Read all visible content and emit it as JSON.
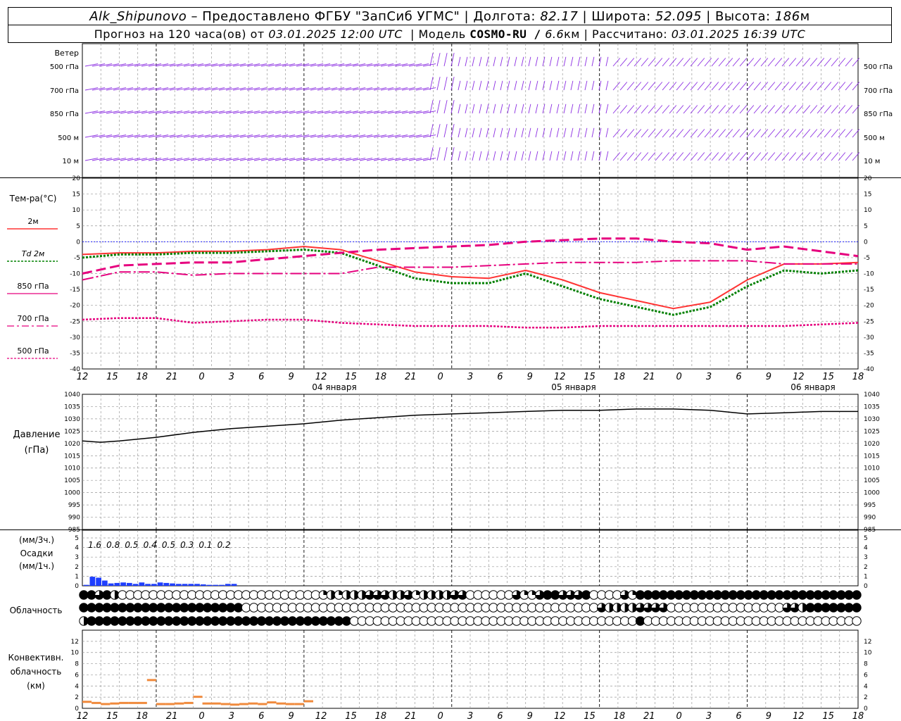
{
  "header": {
    "station": "Alk_Shipunovo",
    "provider": "– Предоставлено ФГБУ \"ЗапСиб УГМС\" |",
    "lon_label": "Долгота:",
    "lon": "82.17",
    "lat_label": "| Широта:",
    "lat": "52.095",
    "alt_label": "| Высота:",
    "alt": "186",
    "alt_unit": "м"
  },
  "subheader": {
    "forecast_label": "Прогноз на 120 часа(ов) от",
    "forecast_from": "03.01.2025 12:00 UTC",
    "model_label": "| Модель",
    "model": "COSMO-RU /",
    "resolution": "6.6",
    "resolution_unit": "км",
    "computed_label": "| Рассчитано:",
    "computed": "03.01.2025 16:39 UTC"
  },
  "panels": {
    "wind": {
      "title": "Ветер",
      "levels": [
        "500 гПа",
        "700 гПа",
        "850 гПа",
        "500 м",
        "10 м"
      ]
    },
    "temperature": {
      "title": "Тем-ра(°С)",
      "legend": [
        "2м",
        "Td 2м",
        "850 гПа",
        "700 гПа",
        "500 гПа"
      ]
    },
    "pressure": {
      "title": "Давление",
      "unit": "(гПа)"
    },
    "precip": {
      "unit3": "(мм/3ч.)",
      "title": "Осадки",
      "unit1": "(мм/1ч.)"
    },
    "cloud": {
      "title": "Облачность"
    },
    "convective": {
      "title": "Конвективн.",
      "title2": "облачность",
      "unit": "(км)"
    }
  },
  "time_axis": {
    "hour_labels": [
      "12",
      "15",
      "18",
      "21",
      "0",
      "3",
      "6",
      "9",
      "12",
      "15",
      "18",
      "21",
      "0",
      "3",
      "6",
      "9",
      "12",
      "15",
      "18",
      "21",
      "0",
      "3",
      "6",
      "9",
      "12",
      "15",
      "18"
    ],
    "dates": [
      "04 января",
      "05 января",
      "06 января"
    ]
  },
  "chart_data": [
    {
      "type": "line",
      "name": "temperature",
      "ylim": [
        -40,
        20
      ],
      "x_hours": [
        0,
        6,
        12,
        18,
        24,
        30,
        36,
        42,
        48,
        54,
        60,
        66,
        72,
        78,
        84,
        90,
        96,
        102,
        108,
        114,
        120,
        126
      ],
      "series": [
        {
          "name": "2м",
          "color": "#ff3333",
          "values": [
            -4,
            -3.5,
            -3.5,
            -3,
            -3,
            -2.5,
            -1.5,
            -2.5,
            -6,
            -9.5,
            -11,
            -11.5,
            -9,
            -12,
            -16,
            -18.5,
            -21,
            -19,
            -12,
            -7,
            -7,
            -6.5
          ]
        },
        {
          "name": "Td 2м",
          "color": "#008000",
          "values": [
            -5,
            -4,
            -4,
            -3.5,
            -3.5,
            -3,
            -2.5,
            -3.5,
            -7.5,
            -11.5,
            -13,
            -13,
            -10,
            -14,
            -18,
            -20.5,
            -23,
            -20.5,
            -14,
            -9,
            -10,
            -9
          ]
        },
        {
          "name": "850 гПа",
          "color": "#e6007e",
          "values": [
            -12,
            -9.5,
            -9.5,
            -10.5,
            -10,
            -10,
            -10,
            -10,
            -8,
            -8,
            -8,
            -7.5,
            -7,
            -6.5,
            -6.5,
            -6.5,
            -6,
            -6,
            -6,
            -7,
            -7,
            -7
          ]
        },
        {
          "name": "700 гПа",
          "color": "#e6007e",
          "values": [
            -10,
            -7.5,
            -7,
            -6.5,
            -6.5,
            -5.5,
            -4.5,
            -3.5,
            -2.5,
            -2,
            -1.5,
            -1,
            0,
            0.5,
            1,
            1,
            0,
            -0.5,
            -2.5,
            -1.5,
            -3,
            -4.5
          ]
        },
        {
          "name": "500 гПа",
          "color": "#e6007e",
          "values": [
            -24.5,
            -24,
            -24,
            -25.5,
            -25,
            -24.5,
            -24.5,
            -25.5,
            -26,
            -26.5,
            -26.5,
            -26.5,
            -27,
            -27,
            -26.5,
            -26.5,
            -26.5,
            -26.5,
            -26.5,
            -26.5,
            -26,
            -25.5
          ]
        }
      ]
    },
    {
      "type": "line",
      "name": "pressure",
      "ylim": [
        985,
        1040
      ],
      "x_hours": [
        0,
        3,
        6,
        12,
        18,
        24,
        30,
        36,
        42,
        48,
        54,
        60,
        66,
        72,
        78,
        84,
        90,
        96,
        102,
        108,
        114,
        120,
        126
      ],
      "values": [
        1021,
        1020.5,
        1021,
        1022.5,
        1024.5,
        1026,
        1027,
        1028,
        1029.5,
        1030.5,
        1031.5,
        1032,
        1032.5,
        1033,
        1033.5,
        1033.5,
        1034,
        1034,
        1033.5,
        1032,
        1032.5,
        1033,
        1033
      ]
    },
    {
      "type": "bar",
      "name": "precipitation_1h",
      "ylim": [
        0,
        5
      ],
      "values": [
        0.1,
        0.95,
        0.85,
        0.55,
        0.25,
        0.3,
        0.35,
        0.3,
        0.2,
        0.35,
        0.2,
        0.2,
        0.35,
        0.3,
        0.25,
        0.2,
        0.2,
        0.2,
        0.2,
        0.15,
        0.1,
        0.1,
        0.1,
        0.2,
        0.2
      ]
    },
    {
      "type": "bar",
      "name": "precipitation_3h_labels",
      "values": [
        "1.6",
        "0.8",
        "0.5",
        "0.4",
        "0.5",
        "0.3",
        "0.1",
        "0.2"
      ]
    },
    {
      "type": "bar",
      "name": "convective_cloud",
      "ylim": [
        0,
        14
      ],
      "values": [
        1.1,
        0.9,
        0.7,
        0.8,
        0.9,
        0.9,
        0.9,
        5,
        0.7,
        0.7,
        0.8,
        0.9,
        2,
        0.8,
        0.8,
        0.7,
        0.6,
        0.7,
        0.8,
        0.7,
        1,
        0.8,
        0.7,
        0.7,
        1.2
      ]
    },
    {
      "type": "table",
      "name": "cloud_cover",
      "levels": [
        "upper",
        "middle",
        "lower"
      ],
      "encoding": "0=clear..4=overcast per 3h step",
      "upper": [
        4,
        4,
        3,
        4,
        2,
        0,
        0,
        0,
        0,
        0,
        0,
        0,
        0,
        0,
        0,
        0,
        0,
        0,
        0,
        0,
        0,
        0,
        0,
        0,
        0,
        0,
        0,
        0,
        0,
        0,
        0,
        1,
        2,
        1,
        2,
        2,
        2,
        3,
        3,
        3,
        2,
        2,
        3,
        1,
        2,
        2,
        2,
        2,
        3,
        3,
        0,
        0,
        0,
        0,
        0,
        0,
        3,
        1,
        1,
        3,
        4,
        4,
        3,
        3,
        3,
        4,
        0,
        0,
        0,
        0,
        3,
        1,
        4,
        4,
        4,
        4,
        4,
        4,
        4,
        4,
        4,
        4,
        4,
        4,
        4,
        4,
        4,
        4,
        4,
        4,
        4,
        4,
        4,
        4,
        4,
        4,
        4,
        4,
        4,
        4,
        4
      ],
      "middle": [
        4,
        4,
        4,
        4,
        4,
        4,
        4,
        4,
        4,
        4,
        4,
        4,
        4,
        4,
        4,
        4,
        4,
        4,
        4,
        4,
        4,
        0,
        0,
        0,
        0,
        0,
        0,
        0,
        0,
        0,
        0,
        0,
        0,
        0,
        0,
        0,
        0,
        0,
        0,
        0,
        0,
        0,
        0,
        0,
        0,
        0,
        0,
        0,
        0,
        0,
        0,
        0,
        0,
        0,
        0,
        0,
        0,
        0,
        0,
        0,
        0,
        0,
        0,
        0,
        0,
        0,
        0,
        3,
        2,
        2,
        2,
        2,
        3,
        3,
        3,
        3,
        0,
        0,
        0,
        0,
        0,
        0,
        0,
        0,
        0,
        0,
        0,
        0,
        0,
        0,
        0,
        3,
        3,
        2,
        4,
        4,
        4,
        4,
        4,
        4,
        4,
        4,
        4,
        4,
        4,
        4,
        3,
        3,
        4,
        3,
        4
      ],
      "lower": [
        2,
        4,
        4,
        4,
        4,
        4,
        4,
        4,
        4,
        4,
        4,
        4,
        4,
        4,
        4,
        4,
        4,
        4,
        4,
        4,
        4,
        4,
        4,
        4,
        4,
        4,
        4,
        4,
        4,
        4,
        4,
        4,
        4,
        4,
        4,
        0,
        0,
        0,
        0,
        0,
        0,
        0,
        0,
        0,
        0,
        0,
        0,
        0,
        0,
        0,
        0,
        0,
        0,
        0,
        0,
        0,
        0,
        0,
        0,
        0,
        0,
        0,
        0,
        0,
        0,
        0,
        0,
        0,
        0,
        0,
        0,
        0,
        4,
        0,
        0,
        0,
        0,
        0,
        0,
        0,
        0,
        0,
        0,
        0,
        0,
        0,
        0,
        0,
        0,
        0,
        0,
        0,
        0,
        0,
        0,
        0,
        0,
        0,
        0,
        0,
        0,
        0,
        0,
        0,
        0,
        0,
        0,
        0,
        0,
        0,
        0,
        0,
        0
      ]
    }
  ],
  "colors": {
    "wind": "#8a2be2",
    "t2m": "#ff3333",
    "td": "#008000",
    "upper_air": "#e6007e",
    "precip": "#1f3fff",
    "convective": "#f08a3c",
    "zero_line": "#0000ff",
    "grid": "#999999"
  }
}
